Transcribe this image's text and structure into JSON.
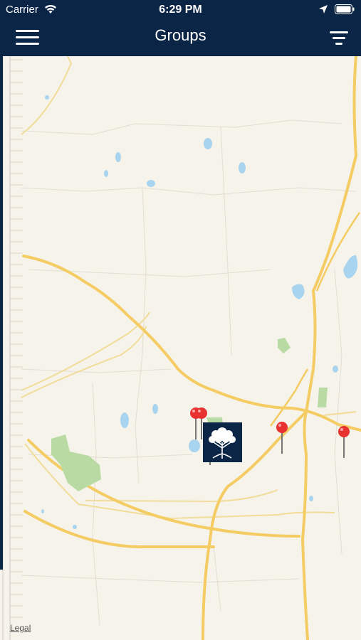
{
  "status_bar": {
    "carrier": "Carrier",
    "time": "6:29 PM"
  },
  "nav": {
    "title": "Groups",
    "menu_icon": "hamburger-menu-icon",
    "filter_icon": "filter-icon"
  },
  "map": {
    "legal": "Legal",
    "pins": [
      {
        "name": "group-pin-1"
      },
      {
        "name": "group-pin-2"
      },
      {
        "name": "group-pin-3"
      },
      {
        "name": "group-pin-4"
      },
      {
        "name": "group-pin-5"
      }
    ],
    "logo_icon": "church-tree-logo-icon"
  },
  "colors": {
    "navbar": "#0a2546",
    "map_background": "#f6f3ea",
    "highway": "#f4cc63",
    "water": "#a9d4ef",
    "park": "#b9dba3",
    "pin": "#e8322f"
  }
}
